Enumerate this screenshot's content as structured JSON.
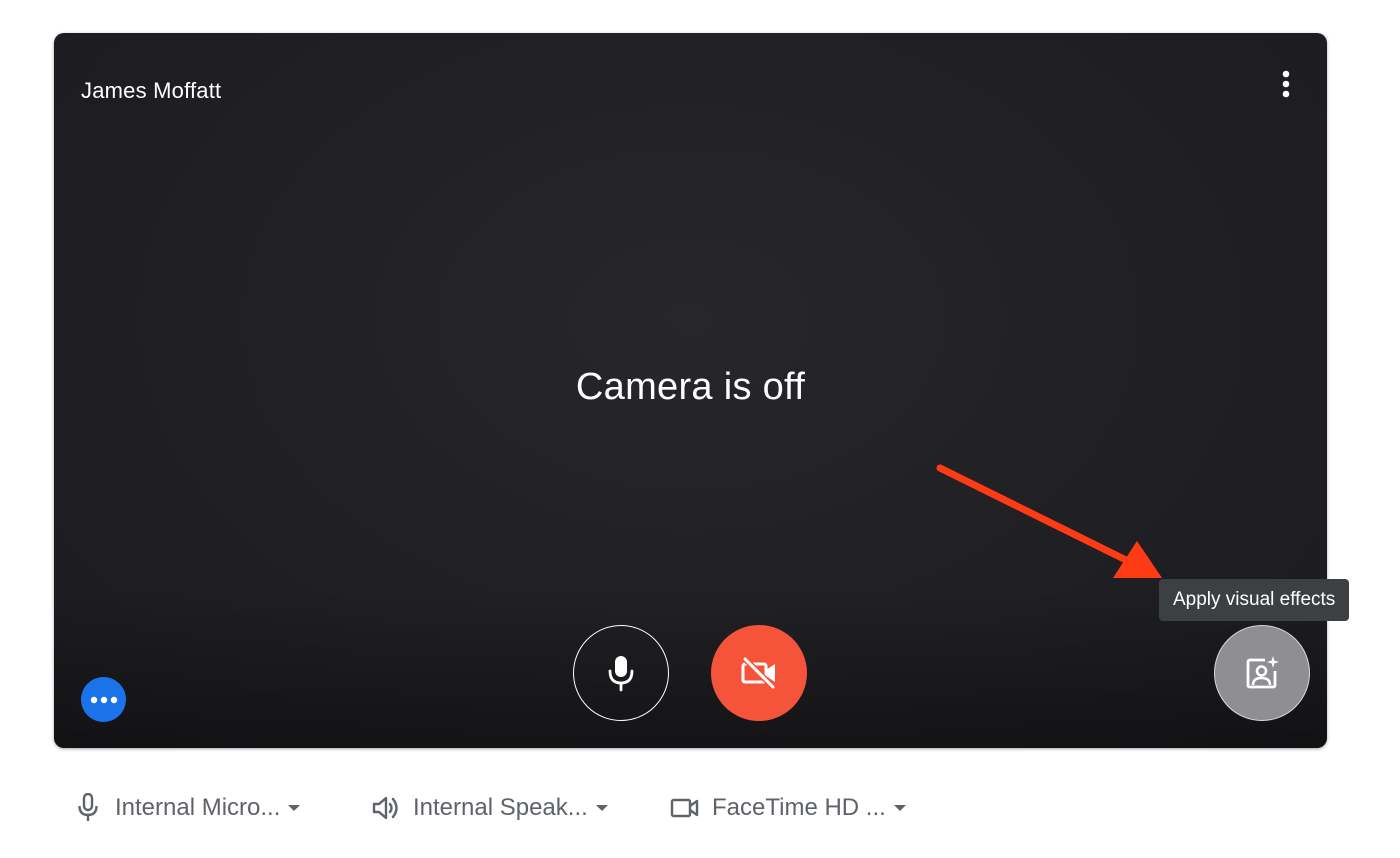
{
  "preview": {
    "participant_name": "James Moffatt",
    "camera_status": "Camera is off",
    "tooltip": "Apply visual effects",
    "controls": {
      "mic_icon": "mic-icon",
      "camera_icon": "videocam-off-icon",
      "effects_icon": "visual-effects-icon",
      "more_options_icon": "more-vert-icon",
      "dots_icon": "more-horiz-icon"
    },
    "colors": {
      "camera_off_button": "#f5543b",
      "dots_button": "#1a73e8",
      "annotation_arrow": "#ff3b16",
      "tooltip_bg": "#3c4043"
    }
  },
  "devices": {
    "microphone": {
      "label": "Internal Micro...",
      "icon": "mic-icon"
    },
    "speaker": {
      "label": "Internal Speak...",
      "icon": "speaker-icon"
    },
    "camera": {
      "label": "FaceTime HD ...",
      "icon": "videocam-icon"
    }
  }
}
